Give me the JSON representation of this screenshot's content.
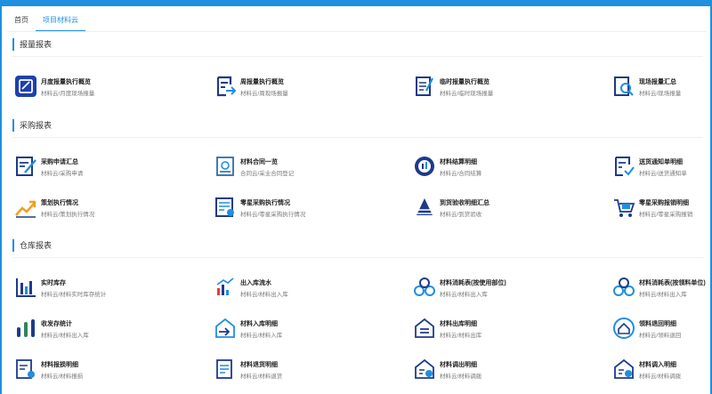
{
  "tabs": [
    {
      "label": "首页"
    },
    {
      "label": "项目材料云"
    }
  ],
  "sections": [
    {
      "title": "报量报表",
      "items": [
        {
          "title": "月度报量执行概览",
          "sub": "材料云/月度现场报量",
          "icon": "monthly-report-icon"
        },
        {
          "title": "周报量执行概览",
          "sub": "材料云/周现场报量",
          "icon": "weekly-report-icon"
        },
        {
          "title": "临时报量执行概览",
          "sub": "材料云/临时现场报量",
          "icon": "temp-report-icon"
        },
        {
          "title": "现场报量汇总",
          "sub": "材料云/现场报量",
          "icon": "site-report-icon"
        }
      ]
    },
    {
      "title": "采购报表",
      "items": [
        {
          "title": "采购申请汇总",
          "sub": "材料云/采购申请",
          "icon": "purchase-request-icon"
        },
        {
          "title": "材料合同一览",
          "sub": "合同云/采业合同登记",
          "icon": "contract-icon"
        },
        {
          "title": "材料结算明细",
          "sub": "材料云/合同结算",
          "icon": "settlement-icon"
        },
        {
          "title": "送货通知单明细",
          "sub": "材料云/送货通知单",
          "icon": "delivery-notice-icon"
        },
        {
          "title": "策划执行情况",
          "sub": "材料云/策划执行情况",
          "icon": "plan-trend-icon"
        },
        {
          "title": "零星采购执行情况",
          "sub": "材料云/零星采购执行情况",
          "icon": "sporadic-purchase-icon"
        },
        {
          "title": "到货验收明细汇总",
          "sub": "材料云/到货验收",
          "icon": "arrival-check-icon"
        },
        {
          "title": "零星采购报销明细",
          "sub": "材料云/零星采购报销",
          "icon": "reimburse-cart-icon"
        }
      ]
    },
    {
      "title": "仓库报表",
      "items": [
        {
          "title": "实时库存",
          "sub": "材料云/材料实时库存统计",
          "icon": "inventory-bars-icon"
        },
        {
          "title": "出入库流水",
          "sub": "材料云/材料出入库",
          "icon": "stock-flow-icon"
        },
        {
          "title": "材料消耗表(按使用部位)",
          "sub": "材料云/材料出入库",
          "icon": "consume-part-icon"
        },
        {
          "title": "材料消耗表(按领料单位)",
          "sub": "材料云/材料出入库",
          "icon": "consume-unit-icon"
        },
        {
          "title": "收发存统计",
          "sub": "材料云/材料出入库",
          "icon": "stock-stats-icon"
        },
        {
          "title": "材料入库明细",
          "sub": "材料云/材料入库",
          "icon": "inbound-icon"
        },
        {
          "title": "材料出库明细",
          "sub": "材料云/材料出库",
          "icon": "outbound-icon"
        },
        {
          "title": "领料退回明细",
          "sub": "材料云/领料退回",
          "icon": "return-icon"
        },
        {
          "title": "材料报损明细",
          "sub": "材料云/材料报损",
          "icon": "damage-report-icon"
        },
        {
          "title": "材料退货明细",
          "sub": "材料云/材料退货",
          "icon": "goods-return-icon"
        },
        {
          "title": "材料调出明细",
          "sub": "材料云/材料调拨",
          "icon": "transfer-out-icon"
        },
        {
          "title": "材料调入明细",
          "sub": "材料云/材料调拨",
          "icon": "transfer-in-icon"
        }
      ]
    }
  ],
  "colors": {
    "accent": "#1f8fe0",
    "navy": "#1e3a8a",
    "gray": "#2b3a4a"
  }
}
